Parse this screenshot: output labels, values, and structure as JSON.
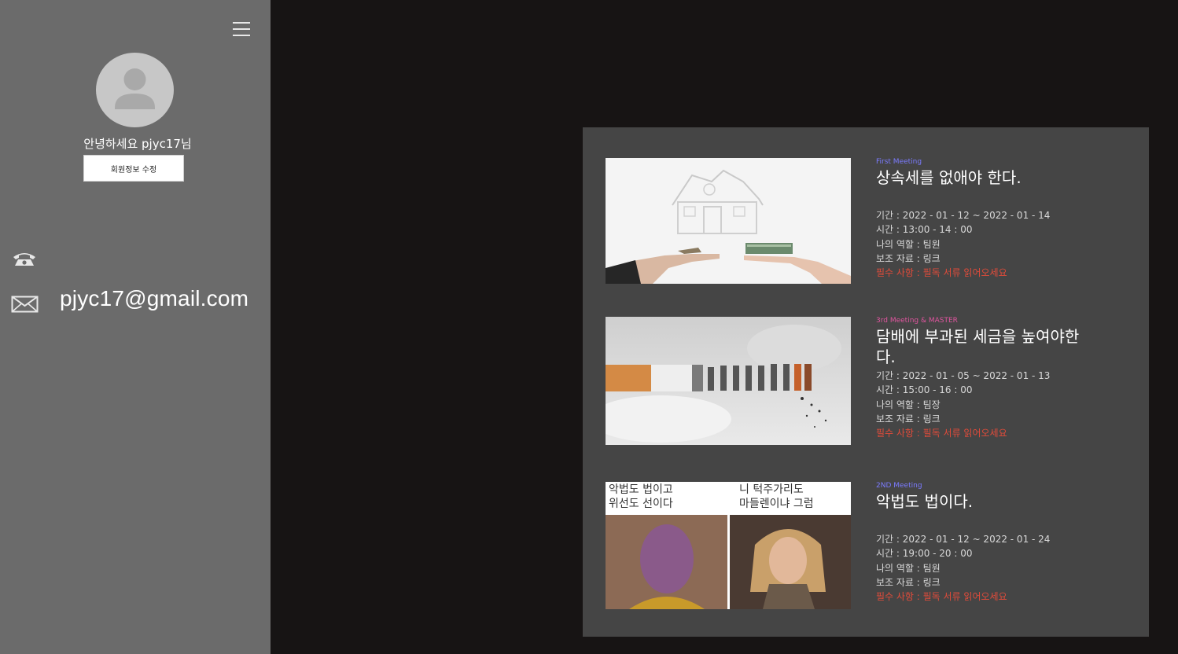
{
  "sidebar": {
    "greeting": "안녕하세요 pjyc17님",
    "edit_button": "회원정보 수정",
    "email": "pjyc17@gmail.com"
  },
  "meetings": [
    {
      "tag": "First Meeting",
      "tag_color": "#7b7bff",
      "title": "상속세를 없애야 한다.",
      "period": "기간 : 2022 - 01 - 12 ~ 2022 - 01 - 14",
      "time": "시간 : 13:00 - 14 : 00",
      "role": "나의 역할 : 팀원",
      "material": "보조 자료 : 링크",
      "required": "필수 사항 : 필독 서류 읽어오세요"
    },
    {
      "tag": "3rd Meeting & MASTER",
      "tag_color": "#e0559f",
      "title": "담배에 부과된 세금을 높여야한다.",
      "period": "기간 : 2022 - 01 - 05 ~ 2022 - 01 - 13",
      "time": "시간 : 15:00 - 16 : 00",
      "role": "나의 역할 : 팀장",
      "material": "보조 자료 : 링크",
      "required": "필수 사항 : 필독 서류 읽어오세요"
    },
    {
      "tag": "2ND Meeting",
      "tag_color": "#7b7bff",
      "title": "악법도 법이다.",
      "period": "기간 : 2022 - 01 - 12 ~ 2022 - 01 - 24",
      "time": "시간 : 19:00 - 20 : 00",
      "role": "나의 역할 : 팀원",
      "material": "보조 자료 : 링크",
      "required": "필수 사항 : 필독 서류 읽어오세요",
      "image_text": {
        "left_line1": "악법도 법이고",
        "left_line2": "위선도 선이다",
        "right_line1": "니 턱주가리도",
        "right_line2": "마들렌이냐 그럼"
      }
    }
  ]
}
